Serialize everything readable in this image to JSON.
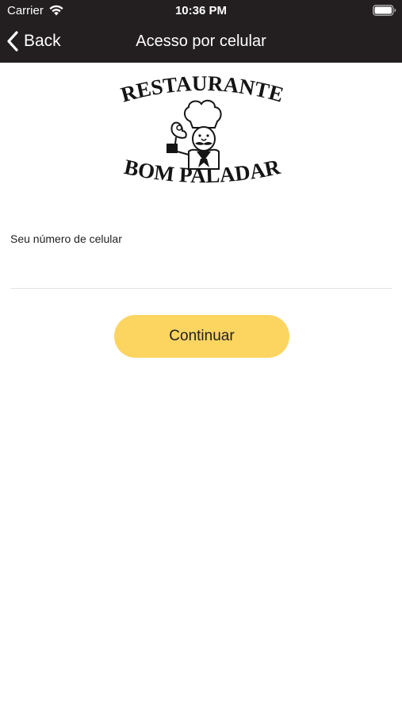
{
  "status_bar": {
    "carrier": "Carrier",
    "time": "10:36 PM",
    "wifi_icon": "wifi-icon",
    "battery_icon": "battery-icon"
  },
  "nav": {
    "back_label": "Back",
    "back_icon": "chevron-left-icon",
    "title": "Acesso por celular"
  },
  "logo": {
    "line1": "RESTAURANTE",
    "line2": "BOM PALADAR",
    "icon": "chef-icon"
  },
  "form": {
    "phone_label": "Seu número de celular",
    "phone_value": "",
    "phone_placeholder": ""
  },
  "actions": {
    "continue_label": "Continuar"
  },
  "colors": {
    "topbar": "#231f20",
    "button": "#fcd561",
    "text": "#222222"
  }
}
